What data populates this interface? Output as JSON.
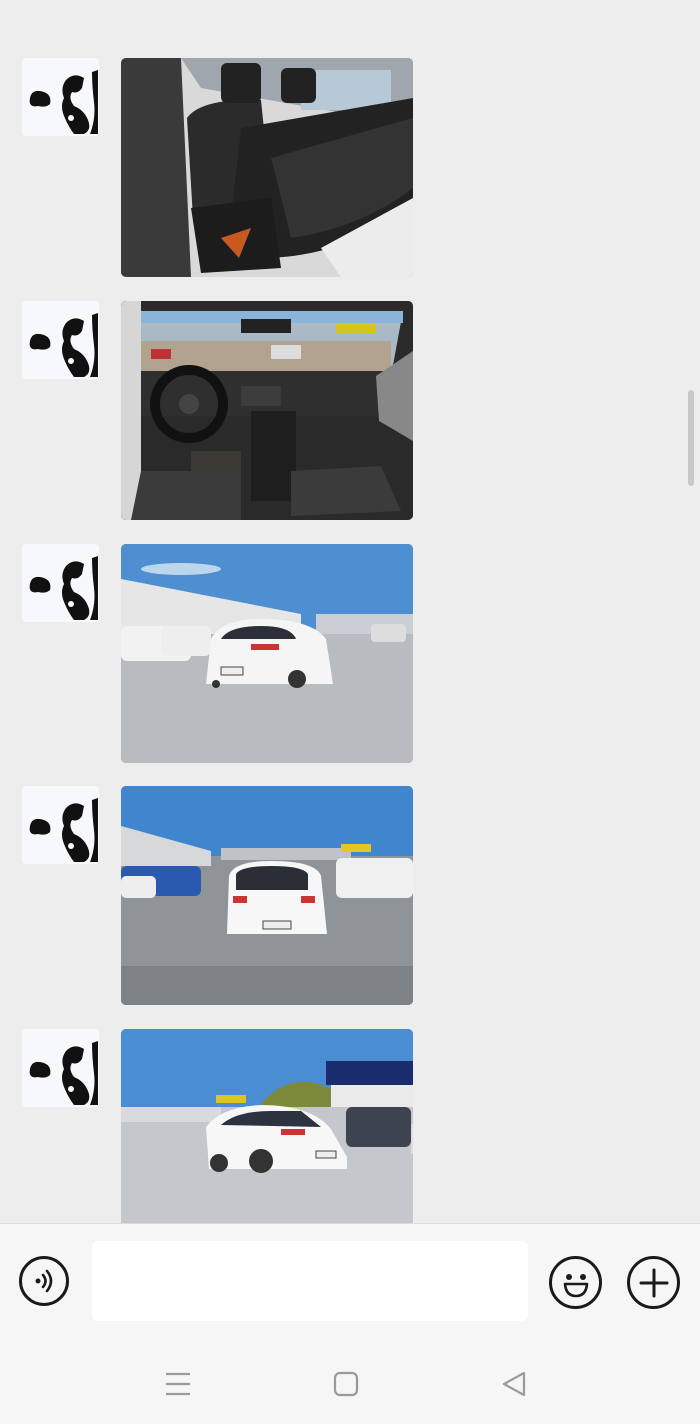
{
  "colors": {
    "background": "#ededed",
    "bottom_bar": "#f6f6f6",
    "input_bg": "#ffffff",
    "icon_stroke": "#1a1a1a",
    "nav_icon": "#9a9a9a"
  },
  "messages": [
    {
      "sender": "contact",
      "type": "image",
      "content": "car-rear-seat-interior"
    },
    {
      "sender": "contact",
      "type": "image",
      "content": "car-dashboard-interior"
    },
    {
      "sender": "contact",
      "type": "image",
      "content": "white-hatchback-rear-left-view"
    },
    {
      "sender": "contact",
      "type": "image",
      "content": "white-hatchback-rear-view"
    },
    {
      "sender": "contact",
      "type": "image",
      "content": "white-hatchback-side-view"
    }
  ],
  "composer": {
    "input_value": "",
    "voice_icon": "voice-icon",
    "emoji_icon": "emoji-icon",
    "plus_icon": "plus-icon"
  },
  "system_nav": {
    "menu_icon": "menu-icon",
    "home_icon": "home-icon",
    "back_icon": "back-icon"
  }
}
